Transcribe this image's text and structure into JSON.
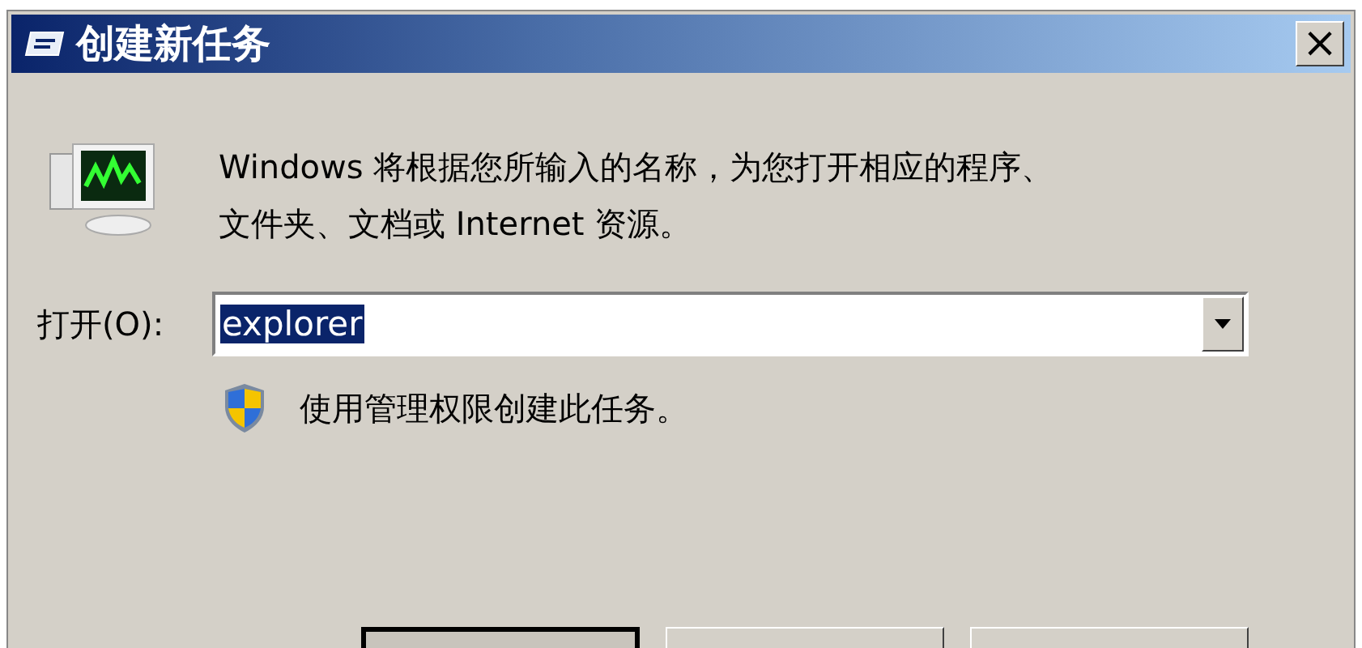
{
  "window": {
    "title": "创建新任务",
    "close": "×"
  },
  "message": {
    "lines": [
      "Windows 将根据您所输入的名称，为您打开相应的程序、",
      "文件夹、文档或 Internet 资源。"
    ]
  },
  "open": {
    "label": "打开(O):",
    "value": "explorer",
    "text_selected": true
  },
  "admin": {
    "label": "使用管理权限创建此任务。"
  },
  "buttons": [
    {
      "default": true
    },
    {
      "default": false
    },
    {
      "default": false
    }
  ]
}
